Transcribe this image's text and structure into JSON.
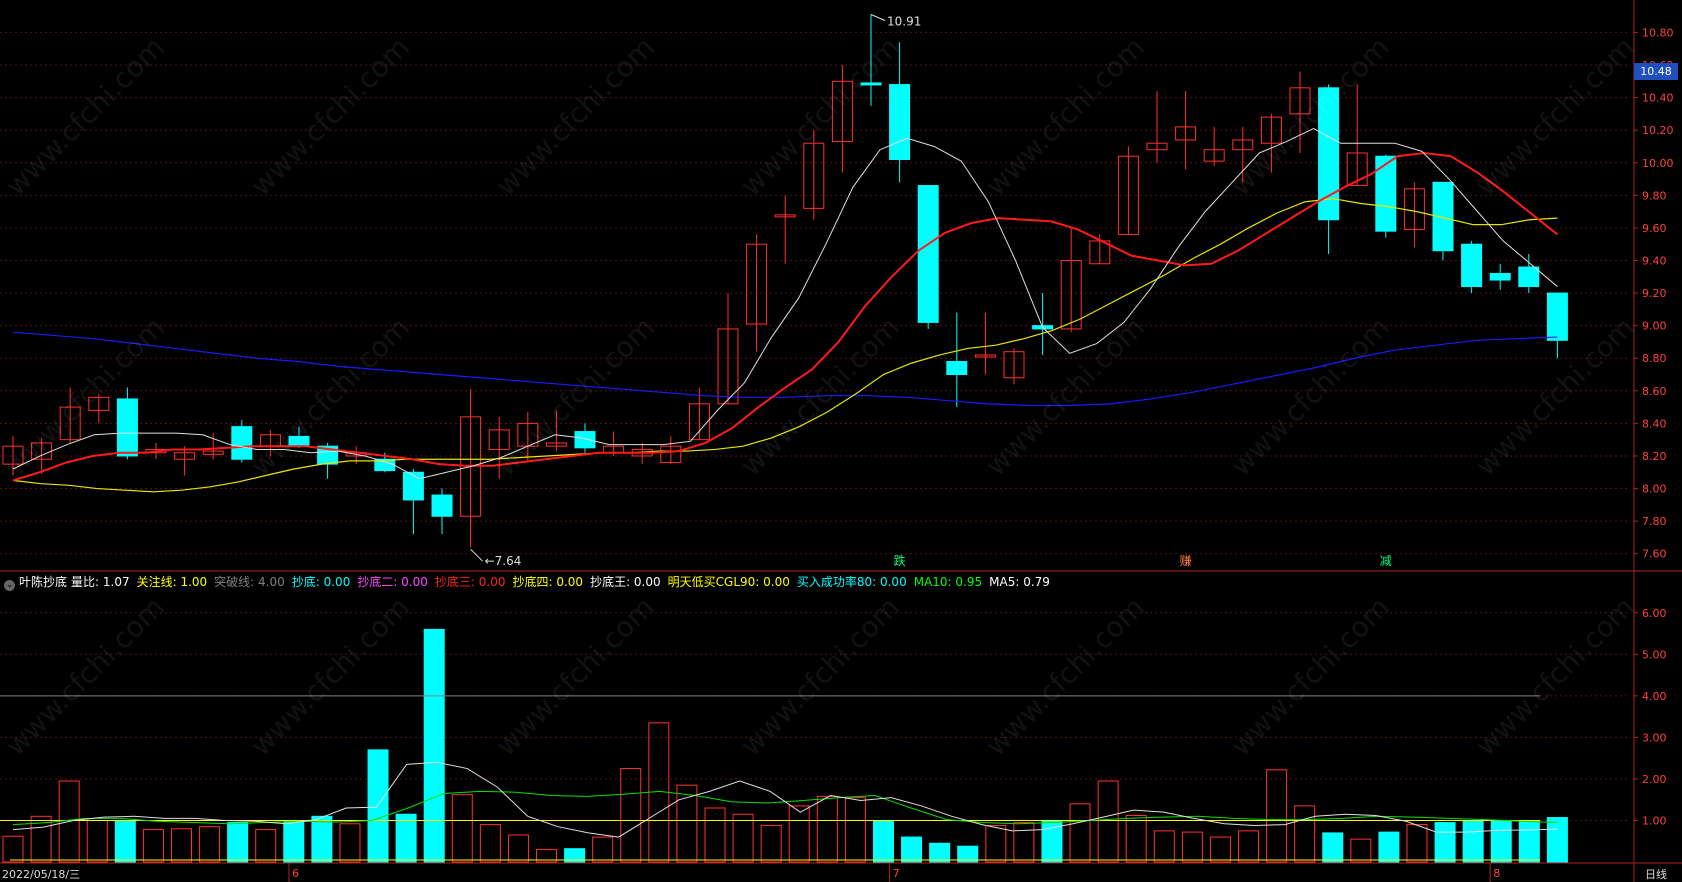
{
  "indicator": {
    "name": "叶陈抄底",
    "items": [
      {
        "label": "量比",
        "value": "1.07",
        "color": "#ffffff"
      },
      {
        "label": "关注线",
        "value": "1.00",
        "color": "#ffff00"
      },
      {
        "label": "突破线",
        "value": "4.00",
        "color": "#808080"
      },
      {
        "label": "抄底",
        "value": "0.00",
        "color": "#00ffff"
      },
      {
        "label": "抄底二",
        "value": "0.00",
        "color": "#ff44ff"
      },
      {
        "label": "抄底三",
        "value": "0.00",
        "color": "#ff2020"
      },
      {
        "label": "抄底四",
        "value": "0.00",
        "color": "#ffff00"
      },
      {
        "label": "抄底王",
        "value": "0.00",
        "color": "#ffffff"
      },
      {
        "label": "明天低买CGL90",
        "value": "0.00",
        "color": "#ffff00"
      },
      {
        "label": "买入成功率80",
        "value": "0.00",
        "color": "#00ffff"
      },
      {
        "label": "MA10",
        "value": "0.95",
        "color": "#00ff00"
      },
      {
        "label": "MA5",
        "value": "0.79",
        "color": "#ffffff"
      }
    ]
  },
  "current_price": "10.48",
  "date_label": "2022/05/18/三",
  "period": "日线",
  "month_labels": [
    {
      "text": "6",
      "index": 10
    },
    {
      "text": "7",
      "index": 31
    },
    {
      "text": "8",
      "index": 52
    }
  ],
  "signals": [
    {
      "text": "跌",
      "index": 31,
      "color": "#00ff80"
    },
    {
      "text": "赚",
      "index": 41,
      "color": "#ff8040"
    },
    {
      "text": "减",
      "index": 48,
      "color": "#00ff80"
    }
  ],
  "extremes": {
    "high_label": "10.91",
    "low_label": "7.64"
  },
  "watermark": "www.cfchi.com",
  "colors": {
    "up": "#ff3030",
    "down": "#00ffff",
    "ma5": "#e0e0e0",
    "ma10": "#ff1a1a",
    "ma20": "#e6e600",
    "ma60": "#1a1aff",
    "vol_ma5": "#e0e0e0",
    "vol_ma10": "#00e000",
    "ref_line": "#ffff00",
    "break_line": "#808080"
  },
  "chart_data": [
    {
      "type": "candlestick",
      "title": "",
      "ylim": [
        7.5,
        10.95
      ],
      "yticks": [
        "7.60",
        "7.80",
        "8.00",
        "8.20",
        "8.40",
        "8.60",
        "8.80",
        "9.00",
        "9.20",
        "9.40",
        "9.60",
        "9.80",
        "10.00",
        "10.20",
        "10.40",
        "10.60",
        "10.80"
      ],
      "candles": [
        {
          "o": 8.15,
          "h": 8.32,
          "l": 8.08,
          "c": 8.26
        },
        {
          "o": 8.18,
          "h": 8.31,
          "l": 8.09,
          "c": 8.28
        },
        {
          "o": 8.3,
          "h": 8.62,
          "l": 8.28,
          "c": 8.5
        },
        {
          "o": 8.48,
          "h": 8.58,
          "l": 8.4,
          "c": 8.56
        },
        {
          "o": 8.55,
          "h": 8.62,
          "l": 8.18,
          "c": 8.2
        },
        {
          "o": 8.22,
          "h": 8.28,
          "l": 8.18,
          "c": 8.24
        },
        {
          "o": 8.18,
          "h": 8.26,
          "l": 8.08,
          "c": 8.22
        },
        {
          "o": 8.21,
          "h": 8.34,
          "l": 8.18,
          "c": 8.23
        },
        {
          "o": 8.38,
          "h": 8.42,
          "l": 8.16,
          "c": 8.18
        },
        {
          "o": 8.26,
          "h": 8.36,
          "l": 8.2,
          "c": 8.33
        },
        {
          "o": 8.32,
          "h": 8.38,
          "l": 8.25,
          "c": 8.26
        },
        {
          "o": 8.26,
          "h": 8.28,
          "l": 8.06,
          "c": 8.15
        },
        {
          "o": 8.2,
          "h": 8.26,
          "l": 8.15,
          "c": 8.22
        },
        {
          "o": 8.18,
          "h": 8.22,
          "l": 8.1,
          "c": 8.11
        },
        {
          "o": 8.1,
          "h": 8.12,
          "l": 7.72,
          "c": 7.93
        },
        {
          "o": 7.96,
          "h": 8.0,
          "l": 7.72,
          "c": 7.83
        },
        {
          "o": 7.83,
          "h": 8.61,
          "l": 7.64,
          "c": 8.44
        },
        {
          "o": 8.24,
          "h": 8.44,
          "l": 8.06,
          "c": 8.36
        },
        {
          "o": 8.26,
          "h": 8.47,
          "l": 8.16,
          "c": 8.4
        },
        {
          "o": 8.26,
          "h": 8.48,
          "l": 8.23,
          "c": 8.28
        },
        {
          "o": 8.35,
          "h": 8.4,
          "l": 8.22,
          "c": 8.25
        },
        {
          "o": 8.22,
          "h": 8.35,
          "l": 8.2,
          "c": 8.26
        },
        {
          "o": 8.2,
          "h": 8.28,
          "l": 8.15,
          "c": 8.24
        },
        {
          "o": 8.16,
          "h": 8.32,
          "l": 8.15,
          "c": 8.26
        },
        {
          "o": 8.3,
          "h": 8.62,
          "l": 8.3,
          "c": 8.52
        },
        {
          "o": 8.52,
          "h": 9.2,
          "l": 8.52,
          "c": 8.98
        },
        {
          "o": 9.01,
          "h": 9.56,
          "l": 8.84,
          "c": 9.5
        },
        {
          "o": 9.68,
          "h": 9.8,
          "l": 9.38,
          "c": 9.68
        },
        {
          "o": 9.72,
          "h": 10.2,
          "l": 9.65,
          "c": 10.12
        },
        {
          "o": 10.13,
          "h": 10.6,
          "l": 9.94,
          "c": 10.5
        },
        {
          "o": 10.49,
          "h": 10.91,
          "l": 10.35,
          "c": 10.48
        },
        {
          "o": 10.48,
          "h": 10.74,
          "l": 9.88,
          "c": 10.02
        },
        {
          "o": 9.86,
          "h": 9.86,
          "l": 8.98,
          "c": 9.02
        },
        {
          "o": 8.78,
          "h": 9.08,
          "l": 8.5,
          "c": 8.7
        },
        {
          "o": 8.82,
          "h": 9.08,
          "l": 8.7,
          "c": 8.82
        },
        {
          "o": 8.68,
          "h": 8.86,
          "l": 8.64,
          "c": 8.84
        },
        {
          "o": 9.0,
          "h": 9.2,
          "l": 8.82,
          "c": 8.98
        },
        {
          "o": 8.98,
          "h": 9.6,
          "l": 8.96,
          "c": 9.4
        },
        {
          "o": 9.38,
          "h": 9.56,
          "l": 9.38,
          "c": 9.52
        },
        {
          "o": 9.56,
          "h": 10.1,
          "l": 9.56,
          "c": 10.04
        },
        {
          "o": 10.08,
          "h": 10.44,
          "l": 10.0,
          "c": 10.12
        },
        {
          "o": 10.14,
          "h": 10.44,
          "l": 9.96,
          "c": 10.22
        },
        {
          "o": 10.01,
          "h": 10.22,
          "l": 9.98,
          "c": 10.08
        },
        {
          "o": 10.08,
          "h": 10.22,
          "l": 9.88,
          "c": 10.14
        },
        {
          "o": 10.12,
          "h": 10.3,
          "l": 9.94,
          "c": 10.28
        },
        {
          "o": 10.3,
          "h": 10.56,
          "l": 10.06,
          "c": 10.46
        },
        {
          "o": 10.46,
          "h": 10.48,
          "l": 9.44,
          "c": 9.65
        },
        {
          "o": 9.86,
          "h": 10.48,
          "l": 9.86,
          "c": 10.06
        },
        {
          "o": 10.04,
          "h": 10.05,
          "l": 9.54,
          "c": 9.58
        },
        {
          "o": 9.59,
          "h": 9.88,
          "l": 9.48,
          "c": 9.84
        },
        {
          "o": 9.88,
          "h": 9.88,
          "l": 9.4,
          "c": 9.46
        },
        {
          "o": 9.5,
          "h": 9.52,
          "l": 9.2,
          "c": 9.24
        },
        {
          "o": 9.32,
          "h": 9.38,
          "l": 9.22,
          "c": 9.28
        },
        {
          "o": 9.36,
          "h": 9.44,
          "l": 9.2,
          "c": 9.24
        },
        {
          "o": 9.2,
          "h": 9.2,
          "l": 8.8,
          "c": 8.91
        }
      ],
      "ma5": [
        8.12,
        8.2,
        8.27,
        8.33,
        8.34,
        8.34,
        8.34,
        8.33,
        8.27,
        8.24,
        8.24,
        8.22,
        8.23,
        8.2,
        8.15,
        8.06,
        8.1,
        8.14,
        8.19,
        8.26,
        8.33,
        8.31,
        8.27,
        8.27,
        8.27,
        8.29,
        8.48,
        8.65,
        8.93,
        9.17,
        9.5,
        9.85,
        10.08,
        10.15,
        10.1,
        10.01,
        9.76,
        9.4,
        8.99,
        8.83,
        8.89,
        9.02,
        9.23,
        9.48,
        9.7,
        9.88,
        10.06,
        10.13,
        10.21,
        10.12,
        10.12,
        10.12,
        10.07,
        9.9,
        9.71,
        9.52,
        9.38,
        9.24
      ],
      "ma10": [
        8.05,
        8.1,
        8.16,
        8.2,
        8.22,
        8.22,
        8.24,
        8.24,
        8.25,
        8.26,
        8.26,
        8.26,
        8.24,
        8.22,
        8.2,
        8.18,
        8.15,
        8.14,
        8.14,
        8.16,
        8.18,
        8.2,
        8.22,
        8.22,
        8.22,
        8.23,
        8.28,
        8.37,
        8.5,
        8.62,
        8.73,
        8.9,
        9.12,
        9.3,
        9.46,
        9.57,
        9.63,
        9.66,
        9.65,
        9.64,
        9.59,
        9.51,
        9.43,
        9.4,
        9.37,
        9.38,
        9.46,
        9.56,
        9.66,
        9.76,
        9.85,
        9.93,
        10.04,
        10.06,
        10.04,
        9.94,
        9.82,
        9.69,
        9.56
      ],
      "ma20": [
        8.05,
        8.03,
        8.02,
        8.0,
        7.99,
        7.98,
        7.99,
        8.01,
        8.04,
        8.08,
        8.12,
        8.15,
        8.17,
        8.17,
        8.18,
        8.18,
        8.18,
        8.18,
        8.19,
        8.2,
        8.21,
        8.22,
        8.22,
        8.23,
        8.23,
        8.24,
        8.26,
        8.31,
        8.38,
        8.47,
        8.58,
        8.7,
        8.77,
        8.82,
        8.86,
        8.88,
        8.92,
        8.97,
        9.04,
        9.13,
        9.22,
        9.31,
        9.41,
        9.5,
        9.6,
        9.69,
        9.76,
        9.78,
        9.75,
        9.73,
        9.7,
        9.66,
        9.62,
        9.62,
        9.65,
        9.66
      ],
      "ma60": [
        8.96,
        8.94,
        8.92,
        8.89,
        8.86,
        8.83,
        8.8,
        8.78,
        8.75,
        8.73,
        8.71,
        8.69,
        8.67,
        8.65,
        8.63,
        8.61,
        8.59,
        8.57,
        8.56,
        8.56,
        8.57,
        8.57,
        8.56,
        8.54,
        8.52,
        8.51,
        8.51,
        8.52,
        8.55,
        8.59,
        8.64,
        8.69,
        8.74,
        8.8,
        8.85,
        8.88,
        8.91,
        8.92,
        8.93
      ]
    },
    {
      "type": "bar",
      "title": "叶陈抄底",
      "ylim": [
        0,
        6.5
      ],
      "yticks": [
        "1.00",
        "2.00",
        "3.00",
        "4.00",
        "5.00",
        "6.00"
      ],
      "values": [
        0.62,
        1.1,
        1.95,
        1.0,
        1.0,
        0.78,
        0.8,
        0.85,
        0.95,
        0.78,
        0.98,
        1.1,
        0.92,
        2.7,
        1.15,
        5.6,
        1.62,
        0.9,
        0.65,
        0.3,
        0.32,
        0.6,
        2.25,
        3.35,
        1.85,
        1.3,
        1.15,
        0.88,
        1.35,
        1.58,
        1.55,
        1.0,
        0.6,
        0.45,
        0.38,
        0.88,
        0.95,
        1.0,
        1.4,
        1.95,
        1.12,
        0.75,
        0.72,
        0.6,
        0.75,
        2.22,
        1.35,
        0.7,
        0.55,
        0.72,
        0.9,
        0.95,
        0.98,
        1.0,
        0.98,
        1.07
      ],
      "ma5": [
        0.78,
        0.84,
        1.0,
        1.08,
        1.1,
        1.05,
        1.05,
        1.0,
        0.98,
        0.92,
        1.02,
        1.3,
        1.32,
        2.35,
        2.4,
        2.25,
        1.8,
        1.1,
        0.85,
        0.7,
        0.6,
        1.05,
        1.5,
        1.7,
        1.95,
        1.7,
        1.2,
        1.6,
        1.48,
        1.55,
        1.35,
        1.1,
        0.9,
        0.75,
        0.78,
        0.92,
        1.08,
        1.25,
        1.2,
        1.05,
        0.92,
        0.88,
        0.9,
        1.1,
        1.15,
        1.12,
        0.98,
        0.72,
        0.72,
        0.76,
        0.77,
        0.79
      ],
      "ma10": [
        0.9,
        0.95,
        1.05,
        1.05,
        0.98,
        0.95,
        0.92,
        0.95,
        0.98,
        0.96,
        1.0,
        1.3,
        1.65,
        1.7,
        1.68,
        1.6,
        1.58,
        1.63,
        1.7,
        1.6,
        1.45,
        1.42,
        1.48,
        1.55,
        1.6,
        1.3,
        1.02,
        0.95,
        0.92,
        0.95,
        1.0,
        1.05,
        1.08,
        1.1,
        1.05,
        1.02,
        1.02,
        1.05,
        1.1,
        1.08,
        1.05,
        1.02,
        0.98,
        0.95
      ],
      "reference_lines": [
        {
          "label": "关注线",
          "value": 1.0
        },
        {
          "label": "突破线",
          "value": 4.0
        }
      ]
    }
  ]
}
